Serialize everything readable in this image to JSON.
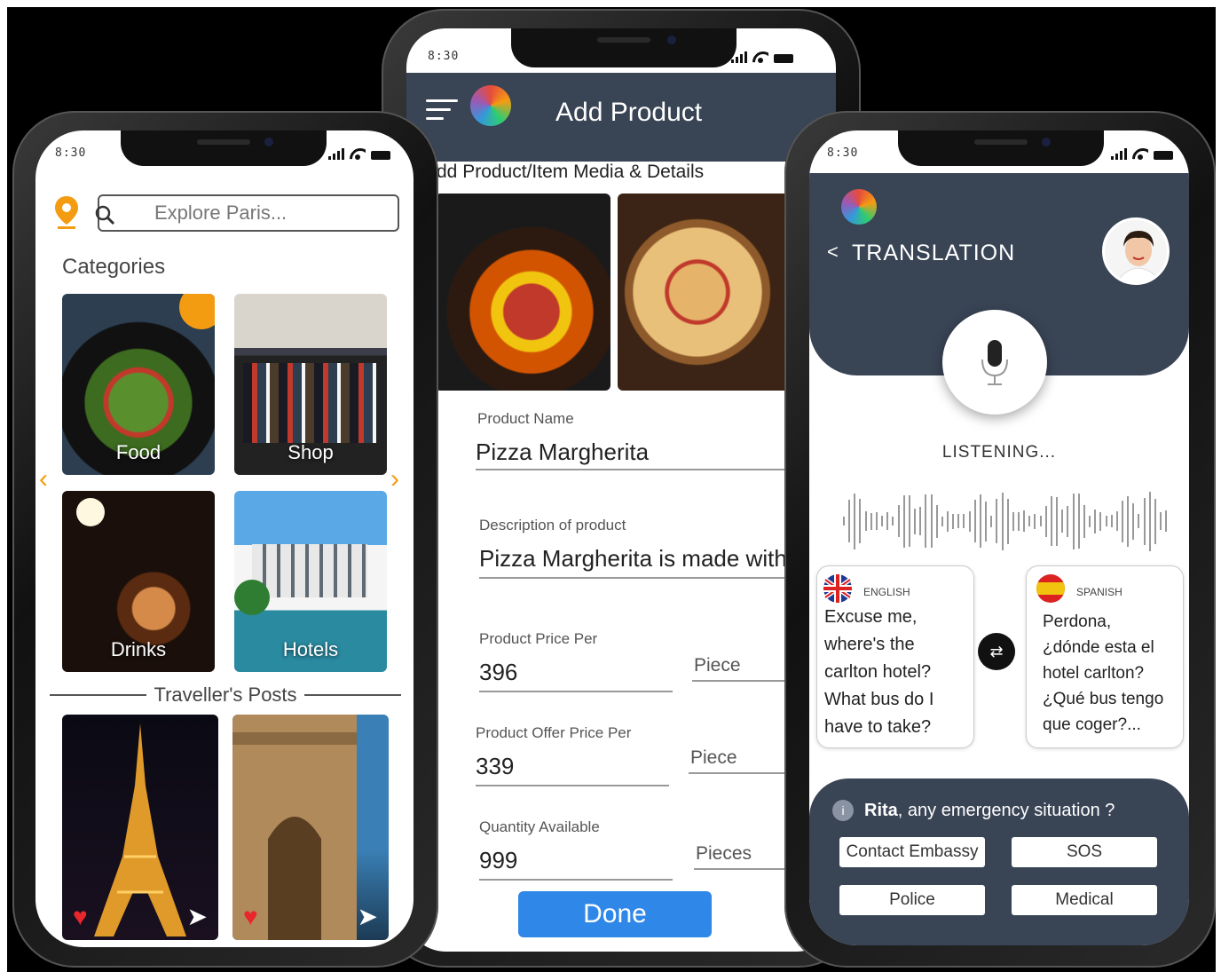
{
  "left": {
    "time": "8:30",
    "search_placeholder": "Explore Paris...",
    "categories_title": "Categories",
    "categories": [
      {
        "label": "Food"
      },
      {
        "label": "Shop"
      },
      {
        "label": "Drinks"
      },
      {
        "label": "Hotels"
      }
    ],
    "posts_title": "Traveller's Posts",
    "nav_prev": "‹",
    "nav_next": "›"
  },
  "middle": {
    "time": "8:30",
    "title": "Add Product",
    "subtitle": "dd Product/Item Media & Details",
    "fields": {
      "name_label": "Product Name",
      "name_value": "Pizza Margherita",
      "desc_label": "Description of product",
      "desc_value": "Pizza Margherita is made with",
      "price_label": "Product Price Per",
      "price_value": "396",
      "price_unit": "Piece",
      "offer_label": "Product Offer Price Per",
      "offer_value": "339",
      "offer_unit": "Piece",
      "qty_label": "Quantity Available",
      "qty_value": "999",
      "qty_unit": "Pieces"
    },
    "done_label": "Done"
  },
  "right": {
    "time": "8:30",
    "title": "TRANSLATION",
    "back": "<",
    "status": "LISTENING...",
    "source": {
      "lang": "ENGLISH",
      "lines": [
        "Excuse me,",
        "where's the",
        "carlton hotel?",
        "What bus do I",
        "have to take?"
      ]
    },
    "target": {
      "lang": "SPANISH",
      "lines": [
        "Perdona,",
        "¿dónde esta el",
        "hotel carlton?",
        "¿Qué bus tengo",
        "que coger?..."
      ]
    },
    "emergency": {
      "name": "Rita",
      "question": ", any emergency situation ?",
      "info": "i",
      "buttons": [
        "Contact Embassy",
        "SOS",
        "Police",
        "Medical"
      ]
    }
  },
  "colors": {
    "header": "#394455",
    "accent_orange": "#f39c12",
    "done_blue": "#2f87e8",
    "heart_red": "#e8262c"
  },
  "icons": [
    "location-pin-icon",
    "search-icon",
    "hamburger-icon",
    "heart-icon",
    "send-icon",
    "mic-icon",
    "swap-icon",
    "info-icon"
  ]
}
